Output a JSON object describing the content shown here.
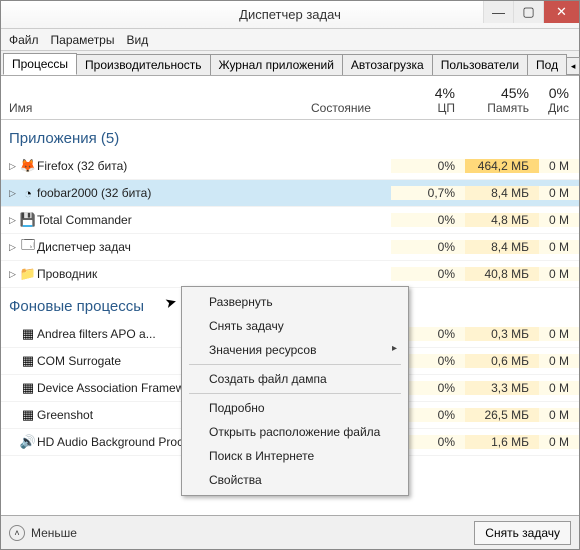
{
  "window": {
    "title": "Диспетчер задач"
  },
  "menu": [
    "Файл",
    "Параметры",
    "Вид"
  ],
  "tabs": {
    "items": [
      "Процессы",
      "Производительность",
      "Журнал приложений",
      "Автозагрузка",
      "Пользователи",
      "Под"
    ],
    "active": 0
  },
  "columns": {
    "name": "Имя",
    "status": "Состояние",
    "cpu": {
      "pct": "4%",
      "label": "ЦП"
    },
    "mem": {
      "pct": "45%",
      "label": "Память"
    },
    "disk": {
      "pct": "0%",
      "label": "Дис"
    }
  },
  "sections": {
    "apps": {
      "title": "Приложения (5)",
      "rows": [
        {
          "icon": "🦊",
          "name": "Firefox (32 бита)",
          "cpu": "0%",
          "mem": "464,2 МБ",
          "memHot": true,
          "disk": "0 М"
        },
        {
          "icon": "◔",
          "name": "foobar2000 (32 бита)",
          "cpu": "0,7%",
          "mem": "8,4 МБ",
          "disk": "0 М",
          "selected": true
        },
        {
          "icon": "💾",
          "name": "Total Commander",
          "cpu": "0%",
          "mem": "4,8 МБ",
          "disk": "0 М"
        },
        {
          "icon": "🗔",
          "name": "Диспетчер задач",
          "cpu": "0%",
          "mem": "8,4 МБ",
          "disk": "0 М"
        },
        {
          "icon": "📁",
          "name": "Проводник",
          "cpu": "0%",
          "mem": "40,8 МБ",
          "disk": "0 М"
        }
      ]
    },
    "bg": {
      "title": "Фоновые процессы",
      "rows": [
        {
          "icon": "▦",
          "name": "Andrea filters APO a...",
          "cpu": "0%",
          "mem": "0,3 МБ",
          "disk": "0 М"
        },
        {
          "icon": "▦",
          "name": "COM Surrogate",
          "cpu": "0%",
          "mem": "0,6 МБ",
          "disk": "0 М"
        },
        {
          "icon": "▦",
          "name": "Device Association Framework Provider H...",
          "cpu": "0%",
          "mem": "3,3 МБ",
          "disk": "0 М"
        },
        {
          "icon": "▦",
          "name": "Greenshot",
          "cpu": "0%",
          "mem": "26,5 МБ",
          "disk": "0 М"
        },
        {
          "icon": "🔊",
          "name": "HD Audio Background Process",
          "cpu": "0%",
          "mem": "1,6 МБ",
          "disk": "0 М"
        }
      ]
    }
  },
  "context_menu": [
    {
      "label": "Развернуть",
      "type": "item"
    },
    {
      "label": "Снять задачу",
      "type": "item"
    },
    {
      "label": "Значения ресурсов",
      "type": "sub"
    },
    {
      "type": "sep"
    },
    {
      "label": "Создать файл дампа",
      "type": "item"
    },
    {
      "type": "sep"
    },
    {
      "label": "Подробно",
      "type": "item"
    },
    {
      "label": "Открыть расположение файла",
      "type": "item"
    },
    {
      "label": "Поиск в Интернете",
      "type": "item"
    },
    {
      "label": "Свойства",
      "type": "item"
    }
  ],
  "statusbar": {
    "fewer": "Меньше",
    "end_task": "Снять задачу"
  }
}
